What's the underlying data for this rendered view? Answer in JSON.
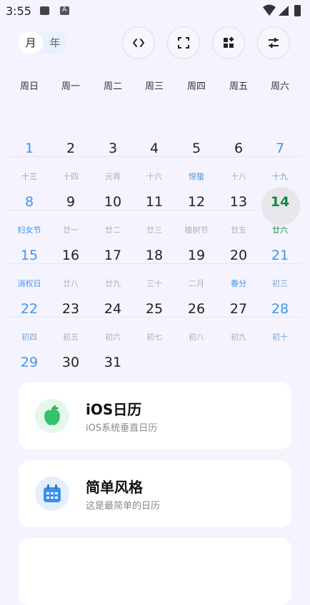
{
  "status_bar": {
    "time": "3:55"
  },
  "view_toggle": {
    "month": "月",
    "year": "年"
  },
  "toolbar_icons": [
    "code-icon",
    "fullscreen-icon",
    "widgets-icon",
    "tune-icon"
  ],
  "weekdays": [
    "周日",
    "周一",
    "周二",
    "周三",
    "周四",
    "周五",
    "周六"
  ],
  "calendar": {
    "today": "14",
    "weeks": [
      {
        "days": [
          "1",
          "2",
          "3",
          "4",
          "5",
          "6",
          "7"
        ],
        "lunar": [
          "十三",
          "十四",
          "元宵",
          "十六",
          "惊蛰",
          "十八",
          "十九"
        ]
      },
      {
        "days": [
          "8",
          "9",
          "10",
          "11",
          "12",
          "13",
          "14"
        ],
        "lunar": [
          "妇女节",
          "廿一",
          "廿二",
          "廿三",
          "植树节",
          "廿五",
          "廿六"
        ]
      },
      {
        "days": [
          "15",
          "16",
          "17",
          "18",
          "19",
          "20",
          "21"
        ],
        "lunar": [
          "消权日",
          "廿八",
          "廿九",
          "三十",
          "二月",
          "春分",
          "初三"
        ]
      },
      {
        "days": [
          "22",
          "23",
          "24",
          "25",
          "26",
          "27",
          "28"
        ],
        "lunar": [
          "初四",
          "初五",
          "初六",
          "初七",
          "初八",
          "初九",
          "初十"
        ]
      },
      {
        "days": [
          "29",
          "30",
          "31"
        ],
        "lunar": []
      }
    ]
  },
  "cards": [
    {
      "title": "iOS日历",
      "subtitle": "iOS系统垂直日历",
      "icon": "apple-icon",
      "accent": "#34c26a"
    },
    {
      "title": "简单风格",
      "subtitle": "这是最简单的日历",
      "icon": "calendar-icon",
      "accent": "#3d8ff0"
    }
  ],
  "colors": {
    "weekend": "#3d96ee",
    "today": "#158a45",
    "background": "#f5f3fd"
  }
}
